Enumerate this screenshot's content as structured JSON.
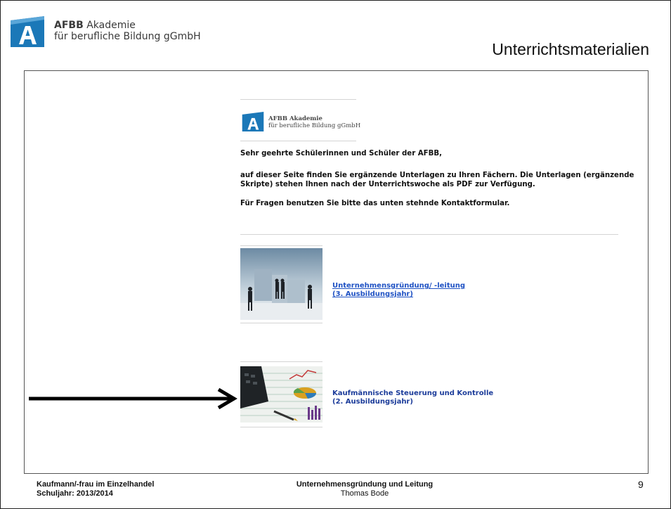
{
  "header": {
    "logo_brand": "AFBB",
    "logo_line1_rest": "Akademie",
    "logo_line2": "für berufliche Bildung gGmbH",
    "title": "Unterrichtsmaterialien"
  },
  "page": {
    "inner_logo_line1": "AFBB Akademie",
    "inner_logo_line2": "für berufliche Bildung gGmbH",
    "greeting": "Sehr geehrte  Schülerinnen und  Schüler der AFBB,",
    "intro_line1": "auf dieser Seite finden Sie ergänzende Unterlagen zu Ihren Fächern. Die Unterlagen (ergänzende",
    "intro_line2": "Skripte) stehen Ihnen nach der Unterrichtswoche als PDF zur Verfügung.",
    "contact_note": "Für Fragen benutzen Sie bitte das unten stehnde Kontaktformular."
  },
  "courses": [
    {
      "title": "Unternehmensgründung/ -leitung",
      "year": "(3. Ausbildungsjahr)",
      "image_icon": "business-people-puzzle-image"
    },
    {
      "title": "Kaufmännische Steuerung und Kontrolle",
      "year": "(2. Ausbildungsjahr)",
      "image_icon": "calculator-charts-image"
    }
  ],
  "footer": {
    "left_line1": "Kaufmann/-frau im Einzelhandel",
    "left_line2": "Schuljahr: 2013/2014",
    "center_line1": "Unternehmensgründung und Leitung",
    "center_line2": "Thomas Bode",
    "page_number": "9"
  },
  "colors": {
    "logo_blue": "#1b78b8",
    "link_blue": "#1f52c4",
    "link_dark_blue": "#1c3c9a"
  }
}
